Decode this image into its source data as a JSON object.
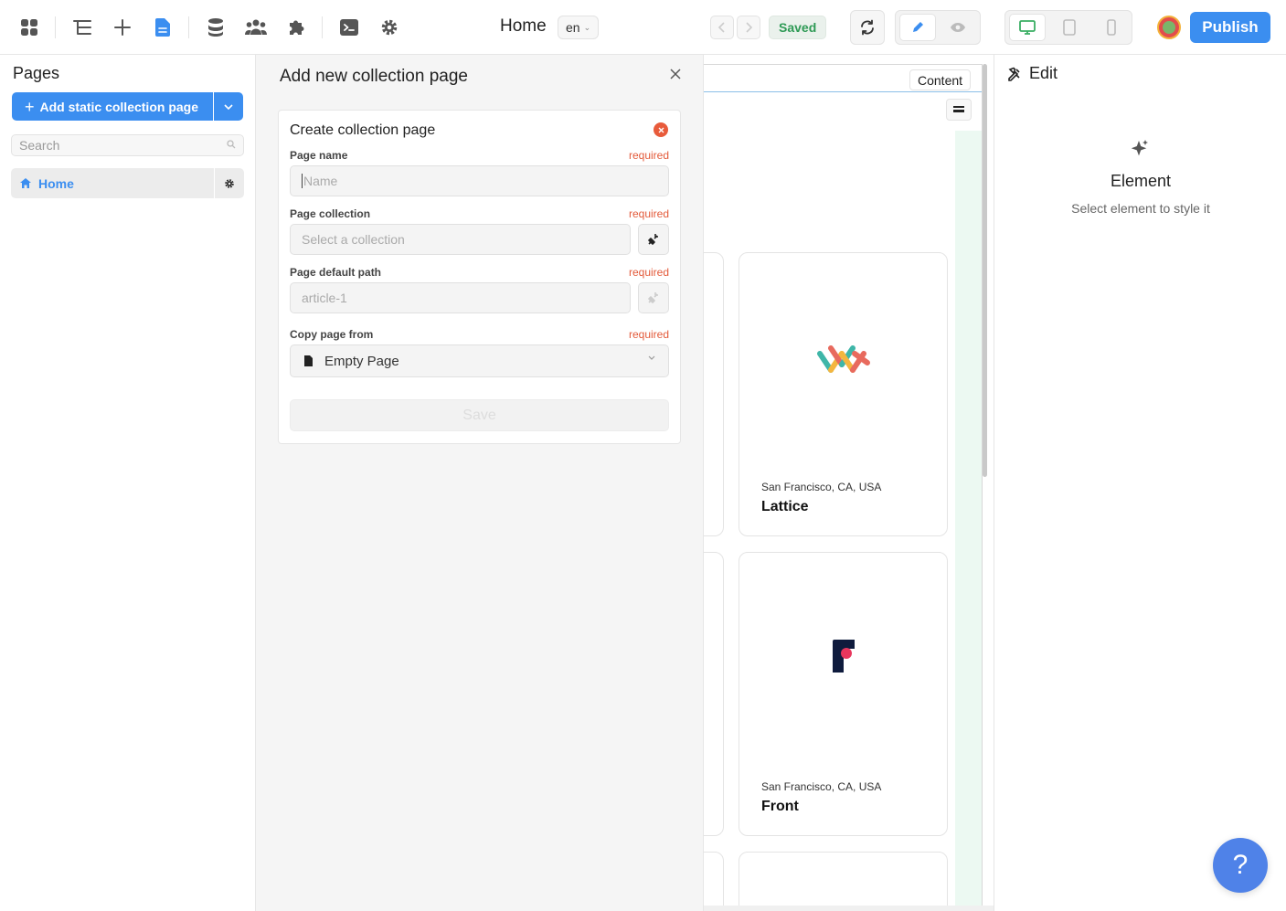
{
  "toolbar": {
    "page_title": "Home",
    "language": "en",
    "status": "Saved",
    "publish_label": "Publish"
  },
  "pages_panel": {
    "title": "Pages",
    "add_button_label": "Add static collection page",
    "search_placeholder": "Search",
    "items": [
      {
        "label": "Home"
      }
    ]
  },
  "dialog": {
    "title": "Add new collection page",
    "card_title": "Create collection page",
    "fields": {
      "page_name": {
        "label": "Page name",
        "required": "required",
        "placeholder": "Name"
      },
      "page_collection": {
        "label": "Page collection",
        "required": "required",
        "placeholder": "Select a collection"
      },
      "page_default_path": {
        "label": "Page default path",
        "required": "required",
        "placeholder": "article-1"
      },
      "copy_page_from": {
        "label": "Copy page from",
        "required": "required",
        "value": "Empty Page"
      }
    },
    "save_label": "Save"
  },
  "canvas": {
    "content_label": "Content",
    "cards": [
      {
        "location": "San Francisco, CA, USA",
        "name": "Lattice"
      },
      {
        "location": "San Francisco, CA, USA",
        "name": "Front"
      }
    ]
  },
  "style_panel": {
    "title": "Edit",
    "element_title": "Element",
    "element_subtitle": "Select element to style it"
  },
  "help_label": "?",
  "colors": {
    "accent": "#3b8ef0",
    "saved_green": "#2e9a55",
    "required_red": "#e35a3a"
  }
}
